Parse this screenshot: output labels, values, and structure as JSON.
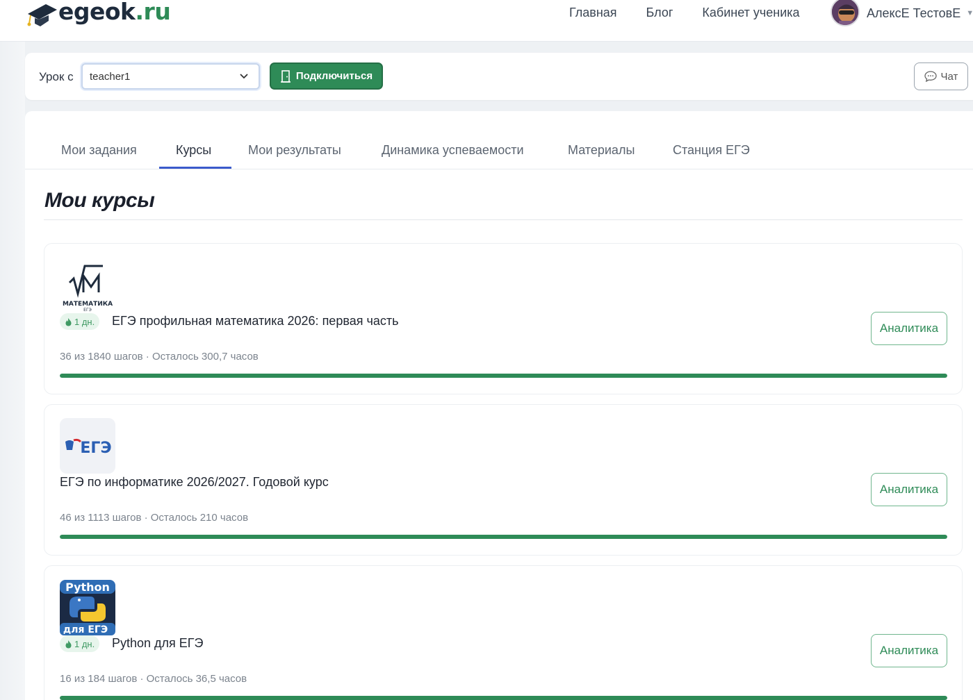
{
  "header": {
    "logo_main": "egeok",
    "logo_tld": ".ru",
    "nav": [
      "Главная",
      "Блог",
      "Кабинет ученика"
    ],
    "user_name": "АлексЕ ТестовЕ",
    "user_caret_icon": "chevron-down-icon"
  },
  "lessonbar": {
    "label": "Урок с",
    "select_value": "teacher1",
    "connect_label": "Подключиться",
    "chat_label": "Чат"
  },
  "tabs": [
    {
      "label": "Мои задания",
      "active": false
    },
    {
      "label": "Курсы",
      "active": true
    },
    {
      "label": "Мои результаты",
      "active": false
    },
    {
      "label": "Динамика успеваемости",
      "active": false
    },
    {
      "label": "Материалы",
      "active": false
    },
    {
      "label": "Станция ЕГЭ",
      "active": false
    }
  ],
  "page_title": "Мои курсы",
  "courses": [
    {
      "logo": "math-logo",
      "logo_text": "МАТЕМАТИКА",
      "logo_sub": "ЕГЭ",
      "streak": "1 дн.",
      "title": "ЕГЭ профильная математика 2026: первая часть",
      "meta": "36 из 1840 шагов · Осталось 300,7 часов",
      "progress": 1.0,
      "analytics_label": "Аналитика"
    },
    {
      "logo": "ege-logo",
      "logo_text": "ЕГЭ",
      "streak": "",
      "title": "ЕГЭ по информатике 2026/2027. Годовой курс",
      "meta": "46 из 1113 шагов · Осталось 210 часов",
      "progress": 1.0,
      "analytics_label": "Аналитика"
    },
    {
      "logo": "python-logo",
      "logo_text": "Python",
      "logo_sub": "для ЕГЭ",
      "streak": "1 дн.",
      "title": "Python для ЕГЭ",
      "meta": "16 из 184 шагов · Осталось 36,5 часов",
      "progress": 1.0,
      "analytics_label": "Аналитика"
    }
  ],
  "colors": {
    "brand_green": "#2e8b57",
    "tab_underline": "#3b5bcc"
  }
}
